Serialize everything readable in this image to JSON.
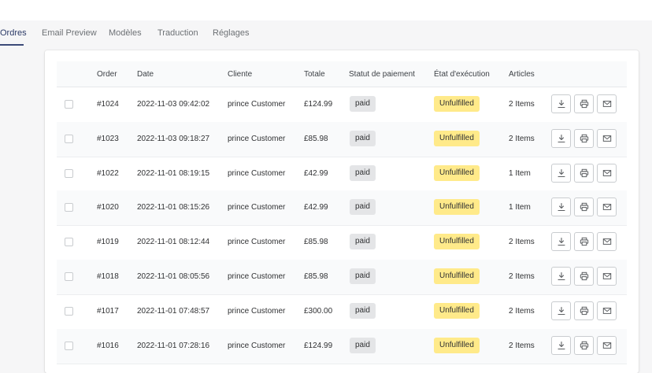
{
  "tabs": [
    {
      "label": "Ordres",
      "active": true
    },
    {
      "label": "Email Preview",
      "active": false
    },
    {
      "label": "Modèles",
      "active": false
    },
    {
      "label": "Traduction",
      "active": false
    },
    {
      "label": "Réglages",
      "active": false
    }
  ],
  "table": {
    "headers": [
      "Order",
      "Date",
      "Cliente",
      "Totale",
      "Statut de paiement",
      "État d'exécution",
      "Articles"
    ],
    "rows": [
      {
        "order": "#1024",
        "date": "2022-11-03 09:42:02",
        "customer": "prince Customer",
        "total": "£124.99",
        "payment": "paid",
        "fulfillment": "Unfulfilled",
        "items": "2 Items"
      },
      {
        "order": "#1023",
        "date": "2022-11-03 09:18:27",
        "customer": "prince Customer",
        "total": "£85.98",
        "payment": "paid",
        "fulfillment": "Unfulfilled",
        "items": "2 Items"
      },
      {
        "order": "#1022",
        "date": "2022-11-01 08:19:15",
        "customer": "prince Customer",
        "total": "£42.99",
        "payment": "paid",
        "fulfillment": "Unfulfilled",
        "items": "1 Item"
      },
      {
        "order": "#1020",
        "date": "2022-11-01 08:15:26",
        "customer": "prince Customer",
        "total": "£42.99",
        "payment": "paid",
        "fulfillment": "Unfulfilled",
        "items": "1 Item"
      },
      {
        "order": "#1019",
        "date": "2022-11-01 08:12:44",
        "customer": "prince Customer",
        "total": "£85.98",
        "payment": "paid",
        "fulfillment": "Unfulfilled",
        "items": "2 Items"
      },
      {
        "order": "#1018",
        "date": "2022-11-01 08:05:56",
        "customer": "prince Customer",
        "total": "£85.98",
        "payment": "paid",
        "fulfillment": "Unfulfilled",
        "items": "2 Items"
      },
      {
        "order": "#1017",
        "date": "2022-11-01 07:48:57",
        "customer": "prince Customer",
        "total": "£300.00",
        "payment": "paid",
        "fulfillment": "Unfulfilled",
        "items": "2 Items"
      },
      {
        "order": "#1016",
        "date": "2022-11-01 07:28:16",
        "customer": "prince Customer",
        "total": "£124.99",
        "payment": "paid",
        "fulfillment": "Unfulfilled",
        "items": "2 Items"
      }
    ],
    "row_actions": [
      "download-icon",
      "print-icon",
      "mail-icon"
    ]
  },
  "colors": {
    "accent": "#3c4a78",
    "paid_badge": "#e4e5e7",
    "unfulfilled_badge": "#ffea8a"
  }
}
